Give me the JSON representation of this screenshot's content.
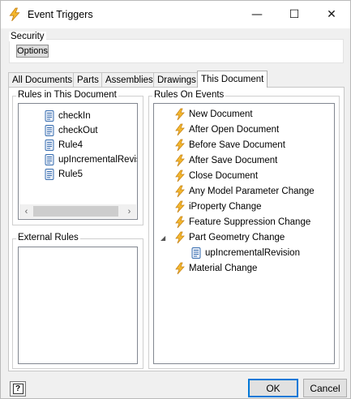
{
  "window": {
    "title": "Event Triggers",
    "title_icon": "lightning-icon"
  },
  "window_controls": {
    "minimize": "—",
    "maximize": "☐",
    "close": "✕"
  },
  "security": {
    "label": "Security",
    "options_button": "Options"
  },
  "tabs": [
    {
      "label": "All Documents",
      "active": false
    },
    {
      "label": "Parts",
      "active": false
    },
    {
      "label": "Assemblies",
      "active": false
    },
    {
      "label": "Drawings",
      "active": false
    },
    {
      "label": "This Document",
      "active": true
    }
  ],
  "rules_in_document": {
    "label": "Rules in This Document",
    "items": [
      "checkIn",
      "checkOut",
      "Rule4",
      "upIncrementalRevision",
      "Rule5"
    ],
    "scroll_left": "‹",
    "scroll_right": "›"
  },
  "external_rules": {
    "label": "External Rules",
    "items": []
  },
  "rules_on_events": {
    "label": "Rules On Events",
    "events": [
      "New Document",
      "After Open Document",
      "Before Save Document",
      "After Save Document",
      "Close Document",
      "Any Model Parameter Change",
      "iProperty Change",
      "Feature Suppression Change",
      "Part Geometry Change",
      "Material Change"
    ],
    "expander_glyph": "◢",
    "child_rule": "upIncrementalRevision"
  },
  "footer": {
    "help": "?",
    "ok": "OK",
    "cancel": "Cancel"
  },
  "colors": {
    "accent": "#0078d7",
    "lightning": "#f5b82e",
    "rule_icon": "#3a6fb0"
  }
}
